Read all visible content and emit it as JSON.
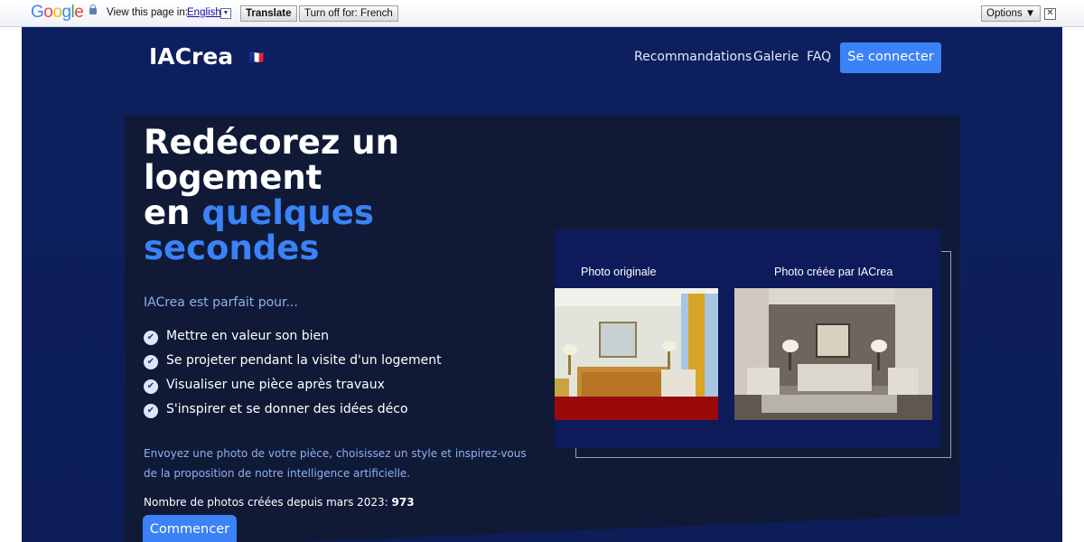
{
  "translate_bar": {
    "logo": "Google",
    "view_label": "View this page in:",
    "language": "English",
    "language_arrow": "▼",
    "translate_button": "Translate",
    "turn_off_button": "Turn off for: French",
    "options_button": "Options ▼",
    "close": "✕"
  },
  "header": {
    "brand": "IACrea",
    "flag": "🇫🇷",
    "nav": [
      "Recommandations",
      "Galerie",
      "FAQ"
    ],
    "login_button": "Se connecter"
  },
  "hero": {
    "title_line1": "Redécorez un logement",
    "title_word_en": "en",
    "title_accent": "quelques secondes",
    "subtitle": "IACrea est parfait pour...",
    "features": [
      "Mettre en valeur son bien",
      "Se projeter pendant la visite d'un logement",
      "Visualiser une pièce après travaux",
      "S'inspirer et se donner des idées déco"
    ],
    "check_glyph": "✔",
    "description": "Envoyez une photo de votre pièce, choisissez un style et inspirez-vous de la proposition de notre intelligence artificielle.",
    "counter_label": "Nombre de photos créées depuis mars 2023:",
    "counter_value": "973",
    "start_button": "Commencer"
  },
  "compare": {
    "original_caption": "Photo originale",
    "ai_caption": "Photo créée par IACrea"
  },
  "colors": {
    "accent": "#3b82f6",
    "site_bg": "#0d1f5e",
    "card_bg": "#101a36"
  }
}
